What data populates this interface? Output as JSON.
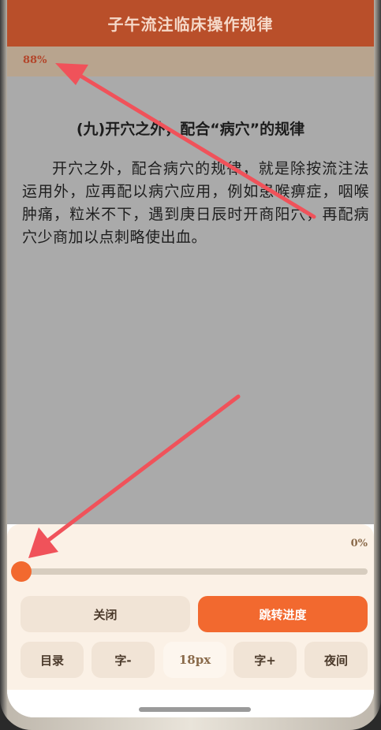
{
  "app": {
    "title": "子午流注临床操作规律"
  },
  "reader": {
    "progress_label": "88%",
    "heading": "(九)开穴之外，配合“病穴”的规律",
    "paragraph": "开穴之外，配合病穴的规律，就是除按流注法运用外，应再配以病穴应用，例如患喉痹症，咽喉肿痛，粒米不下，遇到庚日辰时开商阳穴，再配病穴少商加以点刺略使出血。"
  },
  "progress_panel": {
    "percent_label": "0%",
    "slider_value": 0,
    "close_label": "关闭",
    "jump_label": "跳转进度"
  },
  "toolbar": {
    "toc_label": "目录",
    "font_down_label": "字-",
    "font_size_label": "18px",
    "font_up_label": "字+",
    "night_label": "夜间"
  },
  "colors": {
    "titlebar": "#b94f2a",
    "accent": "#f2692f",
    "panel_bg": "#fbf1e6",
    "annotation_arrow": "#f0525a"
  }
}
